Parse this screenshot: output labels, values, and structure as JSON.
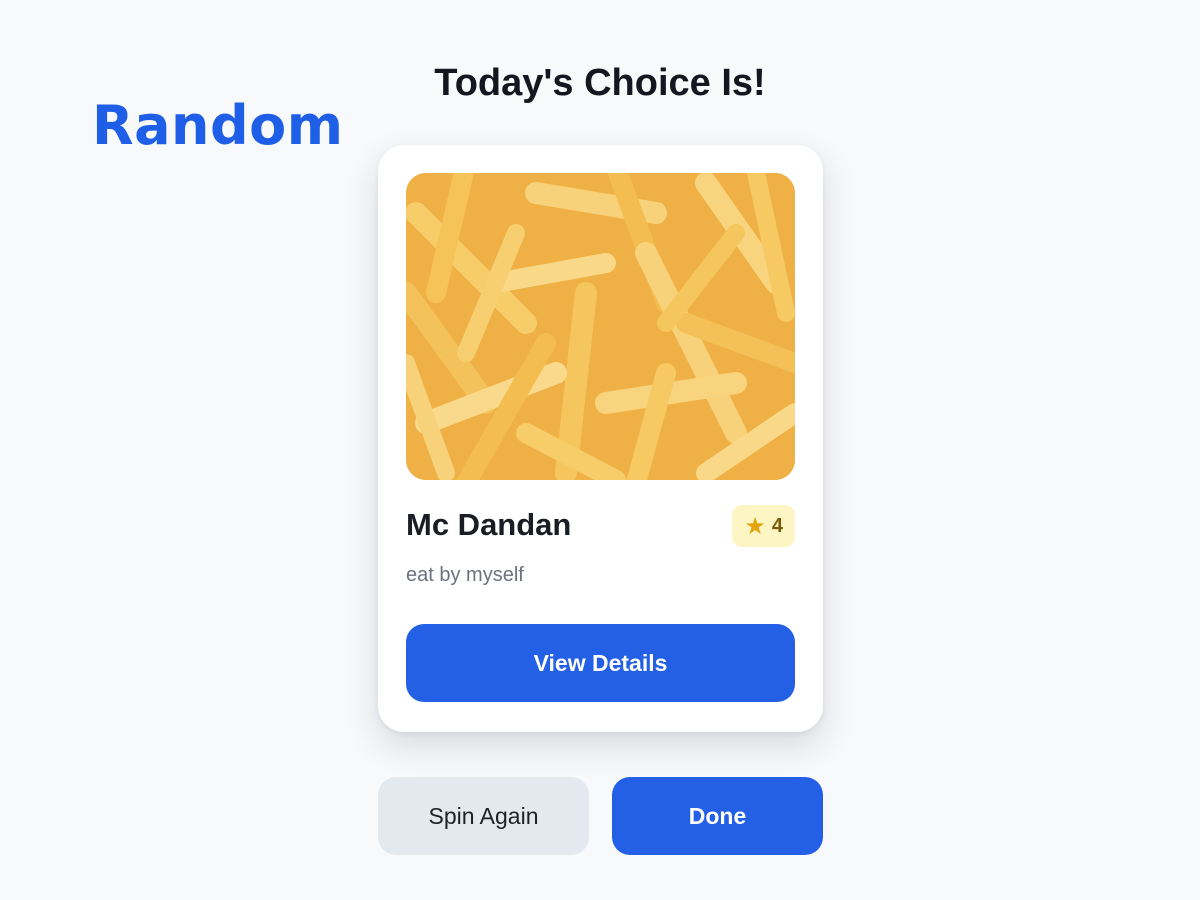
{
  "app": {
    "brand": "Random"
  },
  "page": {
    "heading": "Today's Choice Is!"
  },
  "card": {
    "name": "Mc Dandan",
    "subtitle": "eat by myself",
    "rating": "4",
    "rating_icon": "star-icon",
    "view_button": "View Details"
  },
  "actions": {
    "spin_again": "Spin Again",
    "done": "Done"
  },
  "colors": {
    "accent": "#2360e6",
    "brand": "#1f5fe8",
    "rating_bg": "#fdf5c4",
    "star": "#e3a40c"
  }
}
